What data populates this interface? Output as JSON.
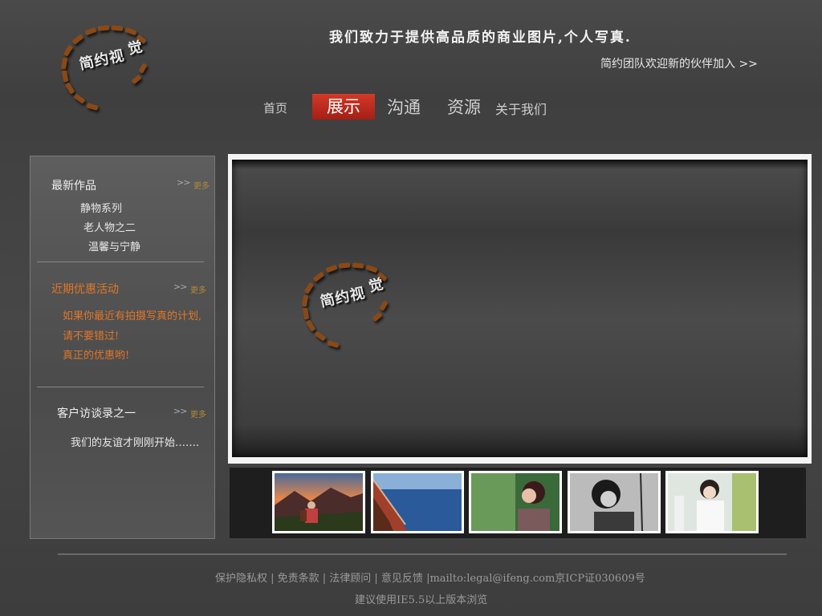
{
  "header": {
    "logo_text_main": "简约视",
    "logo_text_last": "觉",
    "tagline": "我们致力于提供高品质的商业图片,个人写真.",
    "invite": "简约团队欢迎新的伙伴加入 >>"
  },
  "nav": {
    "home": "首页",
    "show": "展示",
    "communicate": "沟通",
    "resources": "资源",
    "about": "关于我们"
  },
  "sidebar": {
    "more_arrow": ">>",
    "more_label": "更多",
    "latest": {
      "title": "最新作品",
      "items": [
        "静物系列",
        "老人物之二",
        "温馨与宁静"
      ]
    },
    "promo": {
      "title": "近期优惠活动",
      "lines": [
        "如果你最近有拍摄写真的计划,",
        "请不要错过!",
        "真正的优惠哟!"
      ]
    },
    "interview": {
      "title": "客户访谈录之一",
      "text": "我们的友谊才刚刚开始……."
    }
  },
  "stage": {
    "logo_text_main": "简约视",
    "logo_text_last": "觉"
  },
  "thumbnails": [
    {
      "name": "hiker-sunset-thumb"
    },
    {
      "name": "pier-ocean-thumb"
    },
    {
      "name": "woman-outdoor-thumb"
    },
    {
      "name": "woman-bw-thumb"
    },
    {
      "name": "woman-white-thumb"
    }
  ],
  "footer": {
    "links": "保护隐私权 | 免责条款 | 法律顾问 | 意见反馈 |mailto:legal@ifeng.com京ICP证030609号",
    "note": "建议使用IE5.5以上版本浏览"
  },
  "colors": {
    "nav_active": "#c22d20",
    "promo_text": "#e0762a",
    "more_link": "#b08a3a"
  }
}
